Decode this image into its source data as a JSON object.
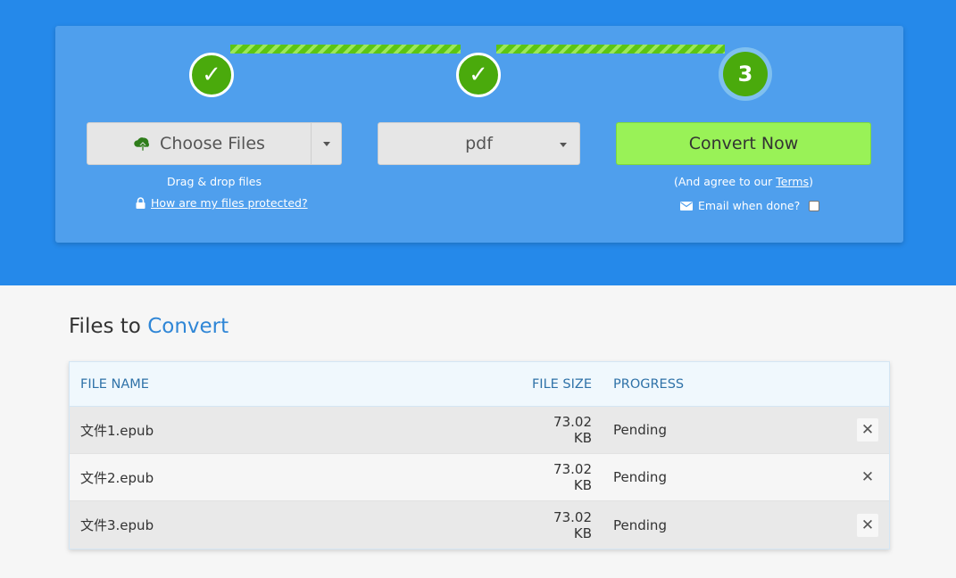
{
  "stepper": {
    "steps": [
      {
        "label": "✓",
        "state": "done"
      },
      {
        "label": "✓",
        "state": "done"
      },
      {
        "label": "3",
        "state": "current"
      }
    ]
  },
  "upload": {
    "choose_label": "Choose Files",
    "drag_text": "Drag & drop files",
    "protect_link": "How are my files protected?"
  },
  "format": {
    "selected": "pdf"
  },
  "convert": {
    "button_label": "Convert Now",
    "agree_prefix": "(And agree to our ",
    "terms_link": "Terms",
    "agree_suffix": ")",
    "email_label": "Email when done?"
  },
  "files": {
    "title_prefix": "Files to",
    "title_accent": "Convert",
    "headers": {
      "name": "FILE NAME",
      "size": "FILE SIZE",
      "progress": "PROGRESS"
    },
    "rows": [
      {
        "name": "文件1.epub",
        "size": "73.02 KB",
        "progress": "Pending"
      },
      {
        "name": "文件2.epub",
        "size": "73.02 KB",
        "progress": "Pending"
      },
      {
        "name": "文件3.epub",
        "size": "73.02 KB",
        "progress": "Pending"
      }
    ]
  },
  "colors": {
    "hero": "#2589ea",
    "panel": "#4f9fed",
    "step_green": "#4aaa0c",
    "convert_button": "#99f257",
    "accent_text": "#2f86d6"
  },
  "icons": [
    "check-icon",
    "cloud-upload-icon",
    "caret-down-icon",
    "lock-icon",
    "envelope-icon",
    "close-icon"
  ]
}
